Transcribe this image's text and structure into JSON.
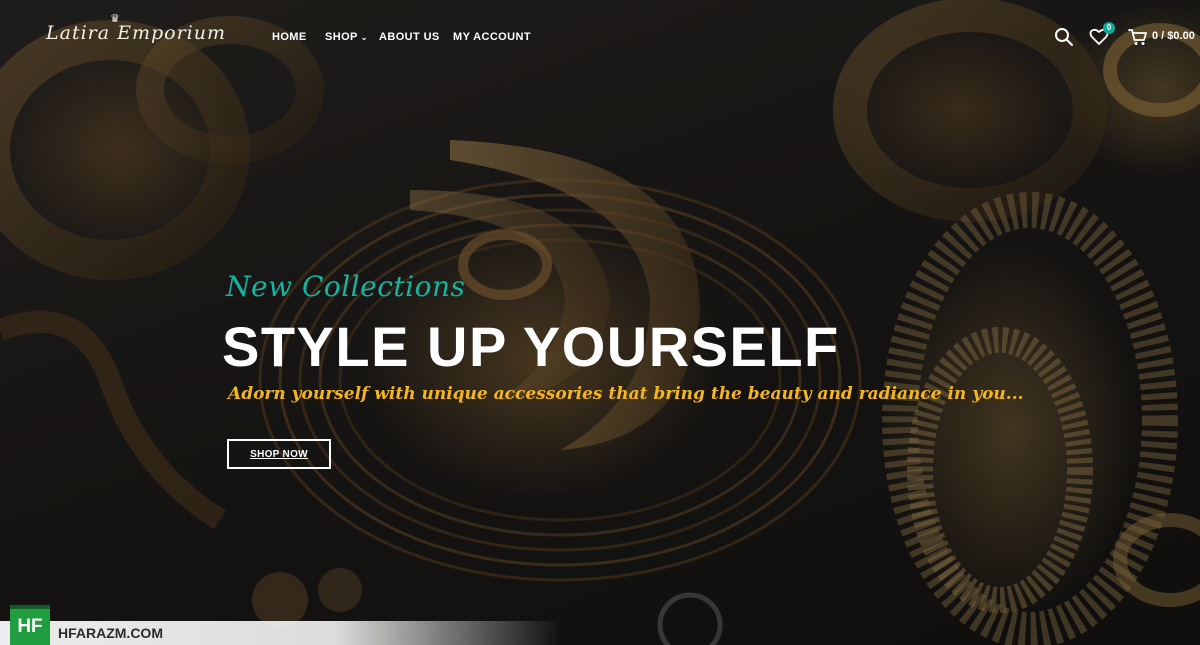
{
  "header": {
    "logo_text": "Latira Emporium",
    "nav": {
      "home": "HOME",
      "shop": "SHOP",
      "about": "ABOUT US",
      "account": "MY ACCOUNT"
    },
    "wishlist_count": "0",
    "cart_text": "0 / $0.00"
  },
  "hero": {
    "eyebrow": "New Collections",
    "headline": "STYLE UP YOURSELF",
    "tagline": "Adorn yourself with unique accessories that bring the beauty and radiance in you...",
    "cta_label": "SHOP NOW"
  },
  "watermark": {
    "logo": "HF",
    "text": "HFARAZM.COM"
  },
  "colors": {
    "accent_teal": "#15b3a0",
    "accent_gold": "#f4b51e",
    "badge": "#13a89e",
    "watermark_green": "#1f9d3f"
  },
  "icons": [
    "search-icon",
    "heart-icon",
    "cart-icon",
    "chevron-down-icon"
  ]
}
